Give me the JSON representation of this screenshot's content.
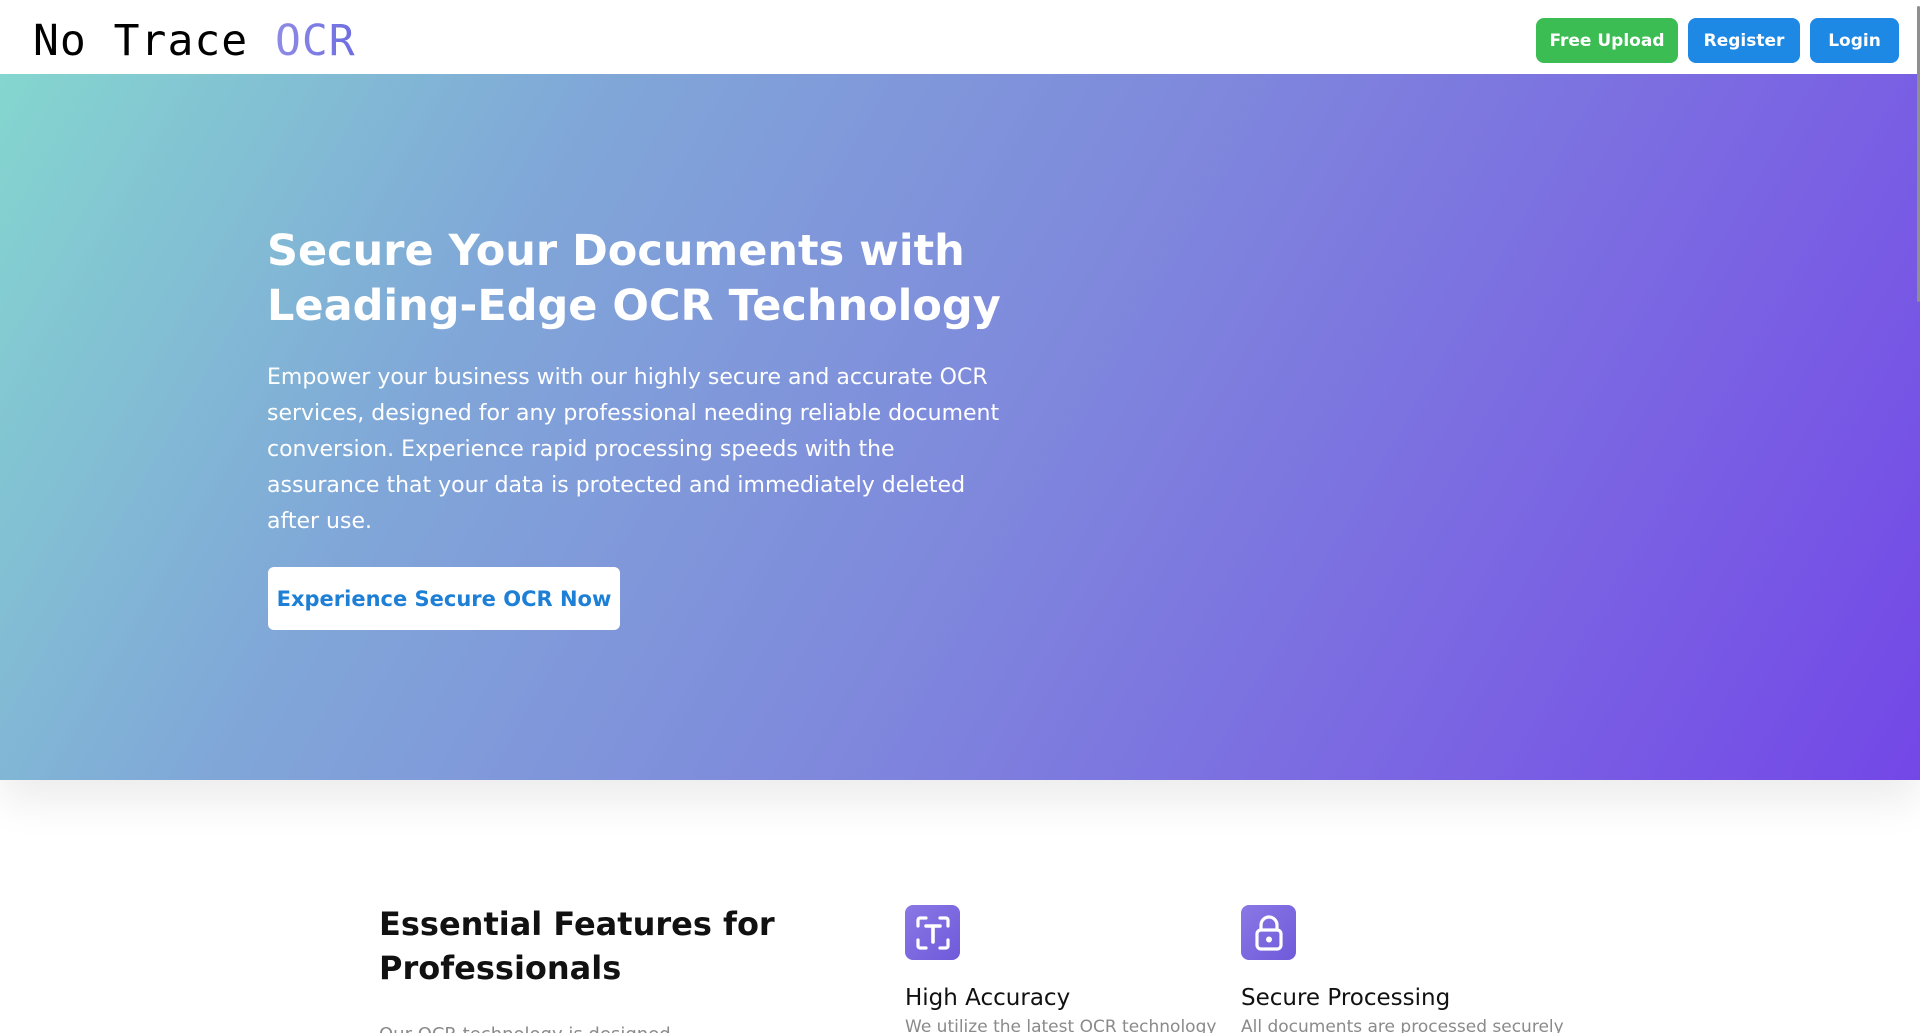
{
  "header": {
    "logo_main": "No Trace ",
    "logo_accent": "OCR",
    "free_upload_label": "Free Upload",
    "register_label": "Register",
    "login_label": "Login"
  },
  "hero": {
    "title": "Secure Your Documents with Leading-Edge OCR Technology",
    "subtitle": "Empower your business with our highly secure and accurate OCR services, designed for any professional needing reliable document conversion. Experience rapid processing speeds with the assurance that your data is protected and immediately deleted after use.",
    "cta_label": "Experience Secure OCR Now"
  },
  "features": {
    "title": "Essential Features for Professionals",
    "description": "Our OCR technology is designed",
    "items": [
      {
        "icon": "text-scan-icon",
        "name": "High Accuracy",
        "text": "We utilize the latest OCR technology"
      },
      {
        "icon": "lock-icon",
        "name": "Secure Processing",
        "text": "All documents are processed securely"
      }
    ]
  },
  "colors": {
    "brand_green": "#3cbd54",
    "brand_blue": "#1e88e5",
    "hero_gradient_start": "#84d6cf",
    "hero_gradient_end": "#7347e7",
    "icon_purple": "#7a67de"
  }
}
